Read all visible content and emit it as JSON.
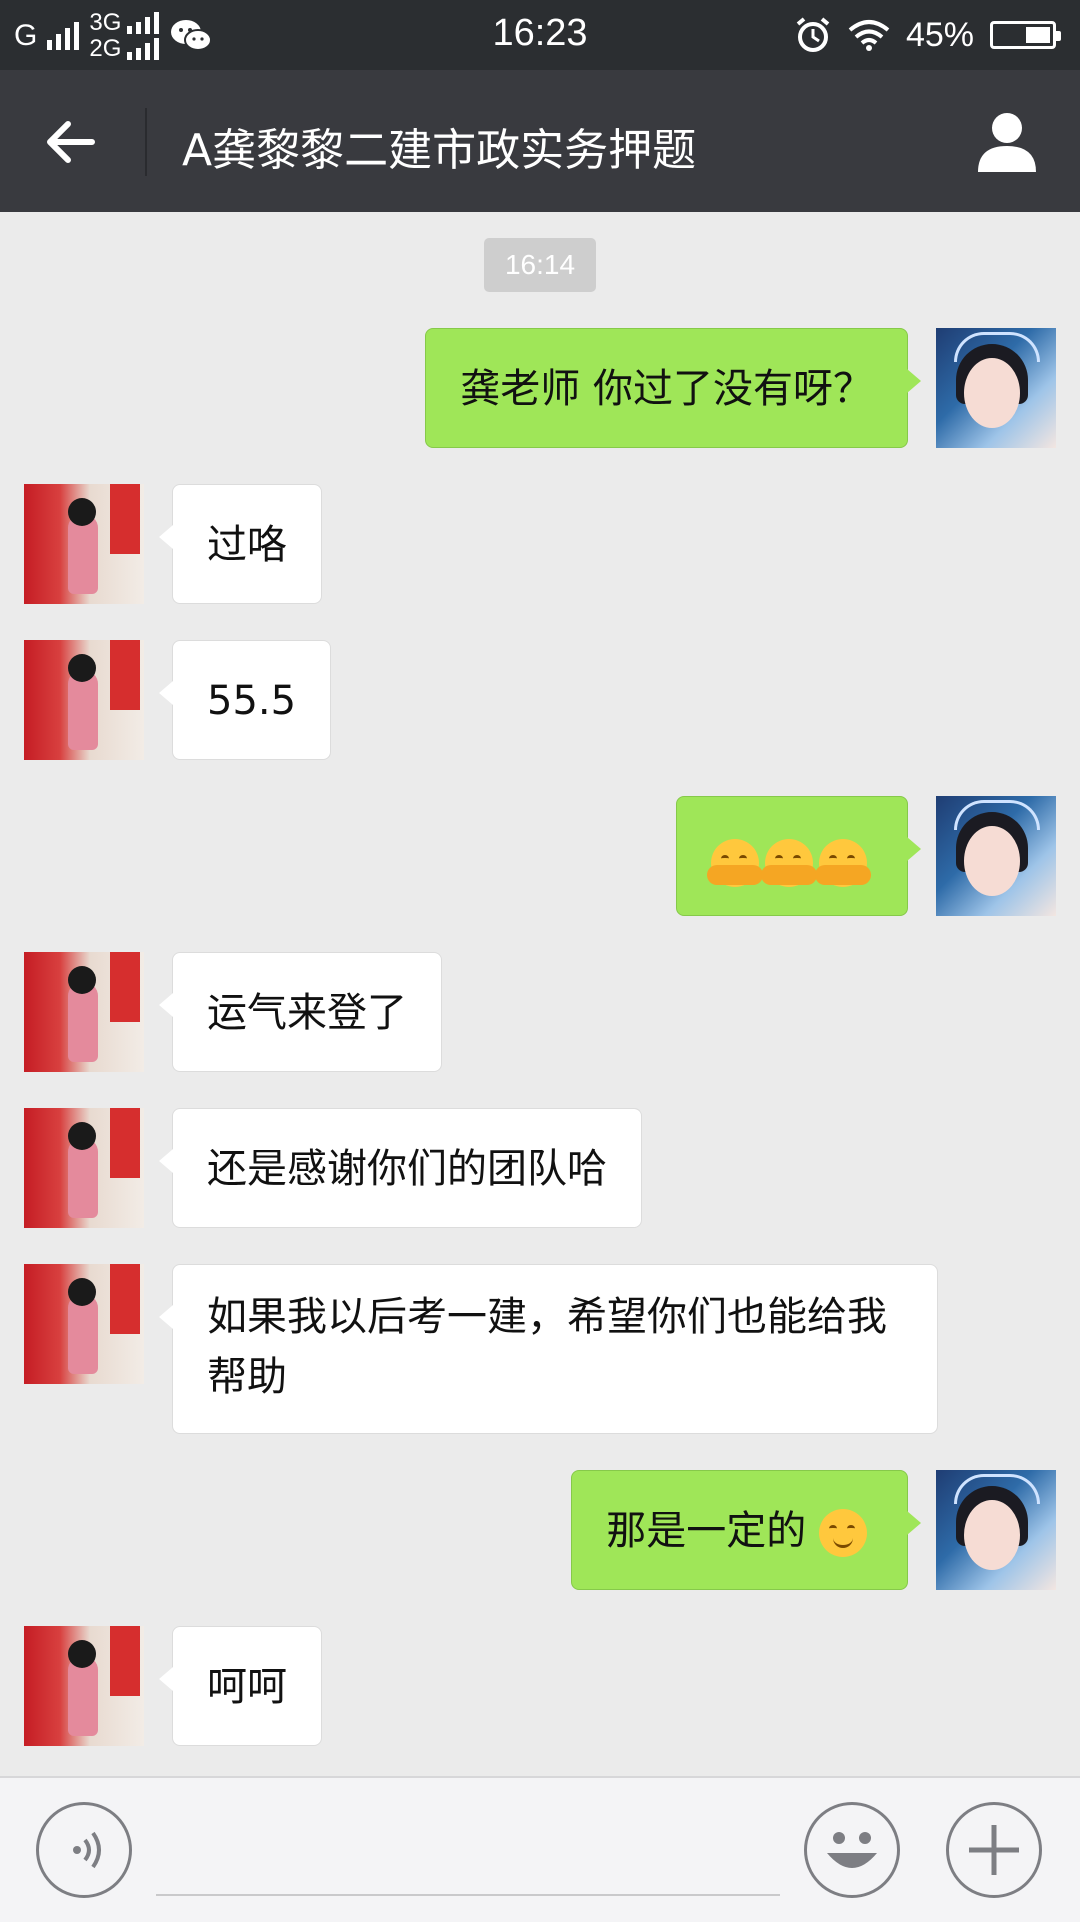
{
  "status_bar": {
    "network_g": "G",
    "network_3g": "3G",
    "network_2g": "2G",
    "time": "16:23",
    "battery": "45%",
    "battery_level": 0.45
  },
  "header": {
    "title": "A龚黎黎二建市政实务押题"
  },
  "chat": {
    "timestamp": "16:14",
    "messages": [
      {
        "side": "out",
        "text": "龚老师  你过了没有呀？"
      },
      {
        "side": "in",
        "text": "过咯"
      },
      {
        "side": "in",
        "text": "55.5"
      },
      {
        "side": "out",
        "text": "",
        "emoji": [
          "hug-emoji",
          "hug-emoji",
          "hug-emoji"
        ]
      },
      {
        "side": "in",
        "text": "运气来登了"
      },
      {
        "side": "in",
        "text": "还是感谢你们的团队哈"
      },
      {
        "side": "in",
        "text": "如果我以后考一建，希望你们也能给我帮助"
      },
      {
        "side": "out",
        "text": "那是一定的 ",
        "emoji": [
          "smile-emoji"
        ]
      },
      {
        "side": "in",
        "text": "呵呵"
      }
    ]
  },
  "colors": {
    "outgoing_bubble": "#9fe658",
    "incoming_bubble": "#ffffff",
    "header_bg": "#393a3f",
    "status_bg": "#2b2e31",
    "chat_bg": "#ebebeb"
  },
  "icons": {
    "back": "arrow-left-icon",
    "profile": "person-icon",
    "voice": "voice-icon",
    "emoji": "smiley-icon",
    "more": "plus-icon",
    "wechat": "wechat-icon",
    "alarm": "alarm-icon",
    "wifi": "wifi-icon"
  }
}
